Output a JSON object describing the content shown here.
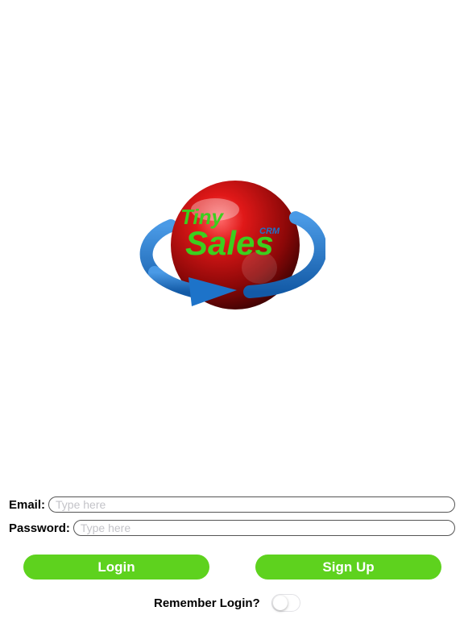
{
  "logo": {
    "line1": "Tiny",
    "line2": "Sales",
    "tag": "CRM",
    "colors": {
      "sphere": "#b00d0d",
      "text": "#3ccf1e",
      "ring": "#1d73c9"
    }
  },
  "form": {
    "email_label": "Email:",
    "email_placeholder": "Type here",
    "email_value": "",
    "password_label": "Password:",
    "password_placeholder": "Type here",
    "password_value": ""
  },
  "buttons": {
    "login_label": "Login",
    "signup_label": "Sign Up",
    "accent": "#5ed21e"
  },
  "remember": {
    "label": "Remember Login?",
    "enabled": false
  }
}
